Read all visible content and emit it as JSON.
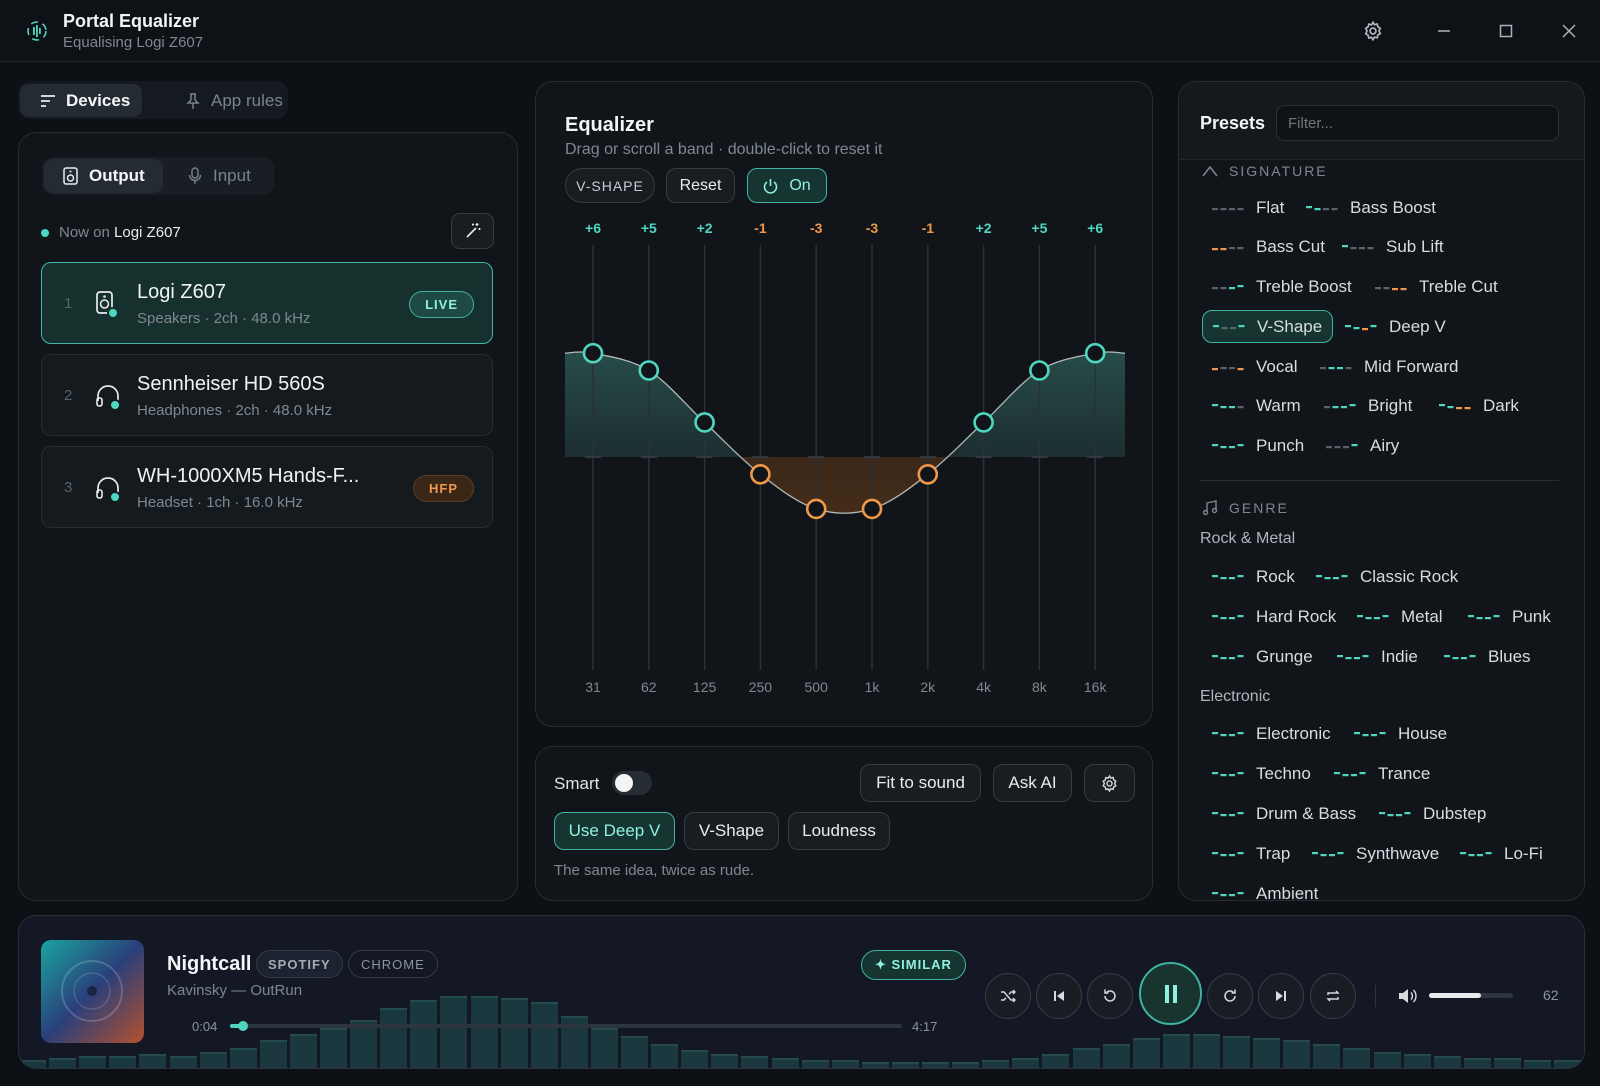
{
  "app": {
    "title": "Portal Equalizer",
    "subtitle": "Equalising Logi Z607"
  },
  "window_controls": [
    "gear-icon",
    "minimize-icon",
    "maximize-icon",
    "close-icon"
  ],
  "nav_tabs": [
    {
      "label": "Devices",
      "active": true
    },
    {
      "label": "App rules",
      "active": false
    }
  ],
  "device_panel": {
    "tabs": [
      {
        "label": "Output",
        "active": true
      },
      {
        "label": "Input",
        "active": false
      }
    ],
    "now_on_prefix": "Now on",
    "now_on_device": "Logi Z607",
    "devices": [
      {
        "num": "1",
        "name": "Logi Z607",
        "meta": "Speakers · 2ch · 48.0 kHz",
        "badge": "LIVE",
        "icon": "speaker-icon"
      },
      {
        "num": "2",
        "name": "Sennheiser HD 560S",
        "meta": "Headphones · 2ch · 48.0 kHz",
        "badge": "",
        "icon": "headphones-icon"
      },
      {
        "num": "3",
        "name": "WH-1000XM5 Hands-F...",
        "meta": "Headset · 1ch · 16.0 kHz",
        "badge": "HFP",
        "icon": "headset-icon"
      }
    ]
  },
  "equalizer": {
    "title": "Equalizer",
    "subtitle": "Drag or scroll a band · double-click to reset it",
    "preset_tag": "V-SHAPE",
    "reset_label": "Reset",
    "power_label": "On",
    "bands": [
      {
        "freq": "31",
        "gain": 6,
        "label": "+6"
      },
      {
        "freq": "62",
        "gain": 5,
        "label": "+5"
      },
      {
        "freq": "125",
        "gain": 2,
        "label": "+2"
      },
      {
        "freq": "250",
        "gain": -1,
        "label": "-1"
      },
      {
        "freq": "500",
        "gain": -3,
        "label": "-3"
      },
      {
        "freq": "1k",
        "gain": -3,
        "label": "-3"
      },
      {
        "freq": "2k",
        "gain": -1,
        "label": "-1"
      },
      {
        "freq": "4k",
        "gain": 2,
        "label": "+2"
      },
      {
        "freq": "8k",
        "gain": 5,
        "label": "+5"
      },
      {
        "freq": "16k",
        "gain": 6,
        "label": "+6"
      }
    ],
    "gain_range": [
      -12,
      12
    ]
  },
  "smart": {
    "label": "Smart",
    "enabled": false,
    "fit_label": "Fit to sound",
    "ask_ai_label": "Ask AI",
    "suggestions": [
      "Use Deep V",
      "V-Shape",
      "Loudness"
    ],
    "caption": "The same idea, twice as rude."
  },
  "presets": {
    "title": "Presets",
    "filter_placeholder": "Filter...",
    "signature_title": "SIGNATURE",
    "signature": [
      "Flat",
      "Bass Boost",
      "Bass Cut",
      "Sub Lift",
      "Treble Boost",
      "Treble Cut",
      "V-Shape",
      "Deep V",
      "Vocal",
      "Mid Forward",
      "Warm",
      "Bright",
      "Dark",
      "Punch",
      "Airy"
    ],
    "selected": "V-Shape",
    "genre_title": "GENRE",
    "rock_title": "Rock & Metal",
    "rock": [
      "Rock",
      "Classic Rock",
      "Hard Rock",
      "Metal",
      "Punk",
      "Grunge",
      "Indie",
      "Blues"
    ],
    "electronic_title": "Electronic",
    "electronic": [
      "Electronic",
      "House",
      "Techno",
      "Trance",
      "Drum & Bass",
      "Dubstep",
      "Trap",
      "Synthwave",
      "Lo-Fi",
      "Ambient"
    ]
  },
  "player": {
    "track": "Nightcall",
    "source1": "SPOTIFY",
    "source2": "CHROME",
    "artist_album": "Kavinsky — OutRun",
    "similar_label": "✦ SIMILAR",
    "elapsed": "0:04",
    "duration": "4:17",
    "progress": 0.016,
    "volume": 62,
    "volume_label": "62"
  },
  "colors": {
    "accent": "#4fd6c0",
    "orange": "#f09848",
    "bg": "#0d1014"
  }
}
